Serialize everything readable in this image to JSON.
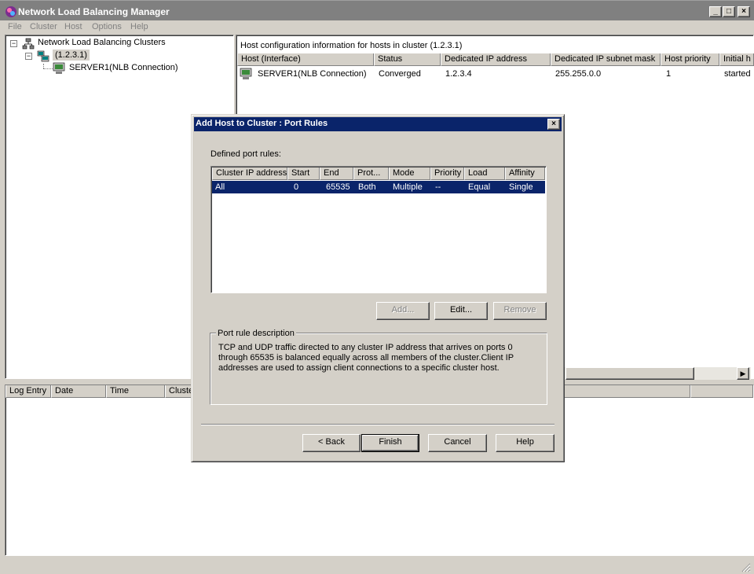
{
  "window": {
    "title": "Network Load Balancing Manager",
    "minimize_label": "_",
    "maximize_label": "□",
    "close_label": "×"
  },
  "menu": [
    "File",
    "Cluster",
    "Host",
    "Options",
    "Help"
  ],
  "tree": {
    "root_label": "Network Load Balancing Clusters",
    "cluster_label": "(1.2.3.1)",
    "host_label": "SERVER1(NLB Connection)",
    "expander_symbol": "−"
  },
  "host_pane": {
    "caption": "Host configuration information for hosts in cluster  (1.2.3.1)",
    "columns": [
      "Host (Interface)",
      "Status",
      "Dedicated IP address",
      "Dedicated IP subnet mask",
      "Host priority",
      "Initial h"
    ],
    "rows": [
      [
        "SERVER1(NLB Connection)",
        "Converged",
        "1.2.3.4",
        "255.255.0.0",
        "1",
        "started"
      ]
    ],
    "scroll_right_symbol": "▶"
  },
  "log_pane": {
    "columns": [
      "Log Entry",
      "Date",
      "Time",
      "Cluste"
    ]
  },
  "dialog": {
    "title": "Add Host to Cluster :  Port Rules",
    "close_label": "×",
    "defined_label": "Defined port rules:",
    "columns": [
      "Cluster IP address",
      "Start",
      "End",
      "Prot...",
      "Mode",
      "Priority",
      "Load",
      "Affinity"
    ],
    "rules": [
      [
        "All",
        "0",
        "65535",
        "Both",
        "Multiple",
        "--",
        "Equal",
        "Single"
      ]
    ],
    "add_button": "Add...",
    "edit_button": "Edit...",
    "remove_button": "Remove",
    "description_legend": "Port rule description",
    "description_text": "TCP and UDP traffic directed to any cluster IP address that arrives on ports 0 through 65535 is balanced equally across all members of the cluster.Client IP addresses are used to assign client connections to a specific cluster host.",
    "back_button": "< Back",
    "finish_button": "Finish",
    "cancel_button": "Cancel",
    "help_button": "Help"
  },
  "colors": {
    "titlebar_inactive": "#808080",
    "dialog_titlebar": "#0a246a",
    "selection": "#0a246a",
    "face": "#d4d0c8"
  }
}
